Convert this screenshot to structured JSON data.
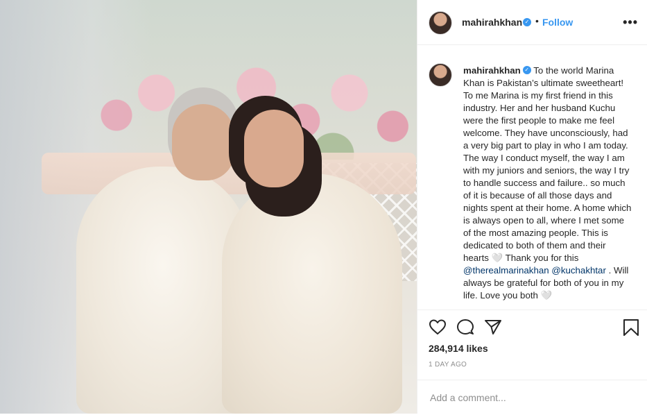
{
  "post": {
    "username": "mahirahkhan",
    "follow_label": "Follow",
    "dot": "•",
    "more_label": "•••",
    "verified_mark": "✓"
  },
  "caption": {
    "username": "mahirahkhan",
    "text_part1": "To the world Marina Khan is Pakistan’s ultimate sweetheart! To me Marina is my first friend in this industry. Her and her husband Kuchu were the first people to make me feel welcome. They have unconsciously, had a very big part to play in who I am today. The way I conduct myself, the way I am with my juniors and seniors, the way I try to handle success and failure.. so much of it is because of all those days and nights spent at their home. A home which is always open to all, where I met some of the most amazing people. This is dedicated to both of them and their hearts 🤍 Thank you for this ",
    "mention1": "@therealmarinakhan",
    "mention2": "@kuchakhtar",
    "text_part2": " . Will always be grateful for both of you in my life. Love you both 🤍"
  },
  "actions": {
    "icons": [
      "heart-icon",
      "comment-icon",
      "share-icon",
      "bookmark-icon"
    ],
    "likes": "284,914 likes",
    "time": "1 DAY AGO"
  },
  "comment_box": {
    "placeholder": "Add a comment..."
  }
}
